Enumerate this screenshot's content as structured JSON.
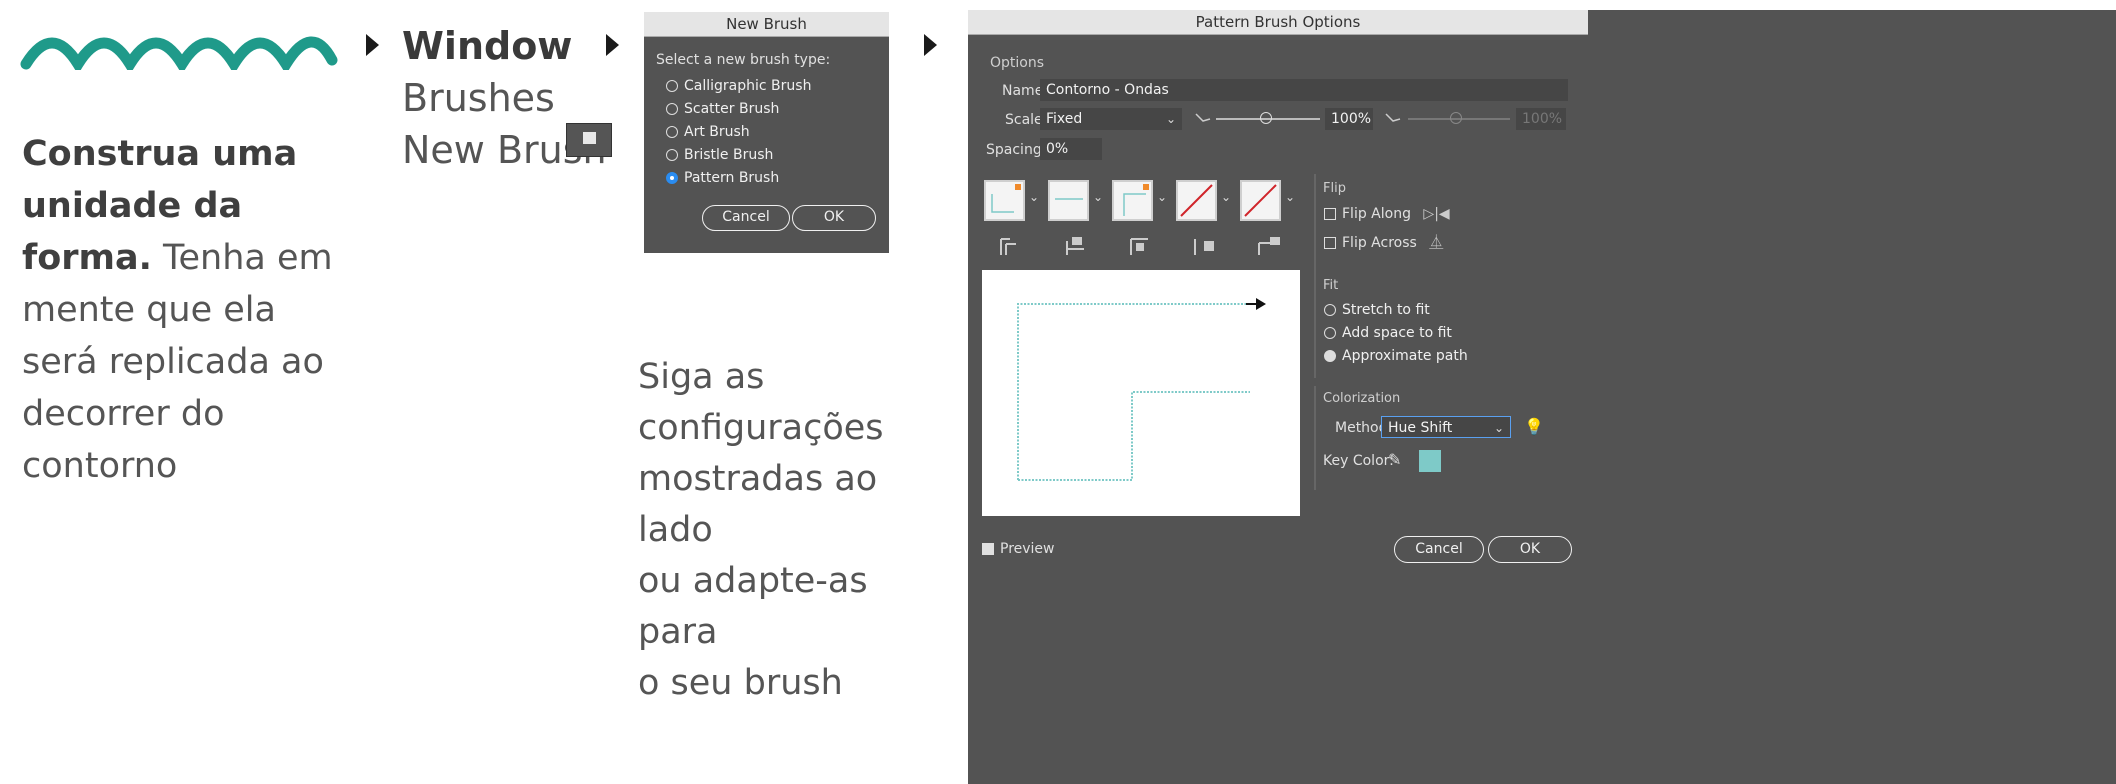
{
  "left": {
    "bold_text": "Construa uma unidade da forma.",
    "bold_lines": [
      "Construa uma",
      "unidade da",
      "forma."
    ],
    "normal_lines": [
      " Tenha em",
      "mente que ela",
      "será replicada ao",
      "decorrer do",
      "contorno"
    ]
  },
  "menu_path": {
    "window": "Window",
    "brushes": "Brushes",
    "new_brush": "New Brush"
  },
  "new_brush_dialog": {
    "title": "New Brush",
    "prompt": "Select a new brush type:",
    "options": [
      {
        "label": "Calligraphic Brush",
        "selected": false
      },
      {
        "label": "Scatter Brush",
        "selected": false
      },
      {
        "label": "Art Brush",
        "selected": false
      },
      {
        "label": "Bristle Brush",
        "selected": false
      },
      {
        "label": "Pattern Brush",
        "selected": true
      }
    ],
    "cancel": "Cancel",
    "ok": "OK"
  },
  "instruction": {
    "lines": [
      "Siga as",
      "configurações",
      "mostradas ao lado",
      "ou adapte-as para",
      "o seu brush"
    ]
  },
  "pattern_dialog": {
    "title": "Pattern Brush Options",
    "options_label": "Options",
    "name_label": "Name:",
    "name_value": "Contorno - Ondas",
    "scale_label": "Scale:",
    "scale_value": "Fixed",
    "scale_percent": "100%",
    "scale_percent_disabled": "100%",
    "spacing_label": "Spacing:",
    "spacing_value": "0%",
    "flip_head": "Flip",
    "flip_along": "Flip Along",
    "flip_across": "Flip Across",
    "fit_head": "Fit",
    "fit_options": [
      {
        "label": "Stretch to fit",
        "selected": false
      },
      {
        "label": "Add space to fit",
        "selected": false
      },
      {
        "label": "Approximate path",
        "selected": true
      }
    ],
    "colorization_head": "Colorization",
    "method_label": "Method:",
    "method_value": "Hue Shift",
    "key_color_label": "Key Color:",
    "key_color": "#7ecac8",
    "preview_label": "Preview",
    "preview_checked": true,
    "cancel": "Cancel",
    "ok": "OK"
  },
  "colors": {
    "wave": "#1f9a8a",
    "dialog_bg": "#535353",
    "accent_blue": "#2a8cf0"
  }
}
